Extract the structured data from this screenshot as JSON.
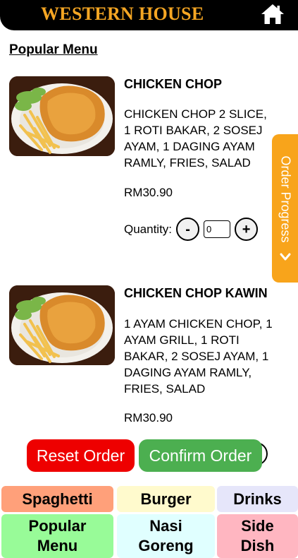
{
  "header": {
    "title": "WESTERN HOUSE",
    "home_icon": "home-icon"
  },
  "section_title": "Popular Menu",
  "items": [
    {
      "name": "CHICKEN CHOP",
      "description": "CHICKEN CHOP 2 SLICE,\n1 ROTI BAKAR, 2 SOSEJ\nAYAM, 1 DAGING AYAM\nRAMLY, FRIES, SALAD",
      "price": "RM30.90",
      "quantity_label": "Quantity:",
      "quantity": "0",
      "minus": "-",
      "plus": "+"
    },
    {
      "name": "CHICKEN CHOP KAWIN",
      "description": "1 AYAM CHICKEN CHOP, 1\nAYAM GRILL, 1 ROTI\nBAKAR, 2 SOSEJ AYAM, 1\nDAGING AYAM RAMLY,\nFRIES, SALAD",
      "price": "RM30.90"
    }
  ],
  "order_progress": {
    "label": "Order Progress",
    "icon": "chevron-down-icon",
    "color": "#f8a41b"
  },
  "actions": {
    "reset": {
      "label": "Reset Order",
      "color": "#ee0000"
    },
    "confirm": {
      "label": "Confirm Order",
      "color": "#4caf50"
    }
  },
  "categories": [
    {
      "label": "Spaghetti",
      "color": "#ffa07a"
    },
    {
      "label": "Burger",
      "color": "#fffacd"
    },
    {
      "label": "Drinks",
      "color": "#e6e6fa"
    },
    {
      "label": "Popular\nMenu",
      "color": "#98fb98"
    },
    {
      "label": "Nasi\nGoreng",
      "color": "#e0ffff"
    },
    {
      "label": "Side\nDish",
      "color": "#ffb6c1"
    }
  ]
}
